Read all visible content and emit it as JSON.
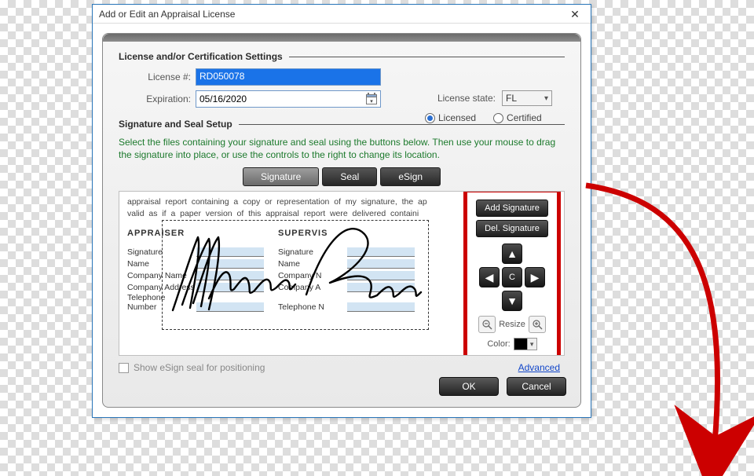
{
  "dialog": {
    "title": "Add or Edit an Appraisal License"
  },
  "section1": {
    "title": "License and/or Certification Settings",
    "license_label": "License #:",
    "license_value": "RD050078",
    "expiration_label": "Expiration:",
    "expiration_value": "05/16/2020",
    "state_label": "License state:",
    "state_value": "FL",
    "radio_licensed": "Licensed",
    "radio_certified": "Certified",
    "licensed_selected": true
  },
  "section2": {
    "title": "Signature and Seal Setup",
    "hint": "Select the files containing your signature and seal using the buttons below. Then use your mouse to drag the signature into place, or use the controls to the right to change its location.",
    "tabs": [
      "Signature",
      "Seal",
      "eSign"
    ],
    "active_tab": "Signature"
  },
  "preview": {
    "legal_line1": "appraisal  report  containing  a  copy  or  representation  of  my  signature,  the  ap",
    "legal_line2": "valid  as  if  a  paper  version  of  this  appraisal  report  were  delivered  containi",
    "left_title": "APPRAISER",
    "right_title": "SUPERVIS",
    "fields_left": [
      "Signature",
      "Name",
      "Company Name",
      "Company Address"
    ],
    "fields_right": [
      "Signature",
      "Name",
      "Company N",
      "Company A"
    ],
    "telephone": "Telephone Number",
    "telephone_r": "Telephone N"
  },
  "controls": {
    "add": "Add Signature",
    "del": "Del. Signature",
    "center": "C",
    "resize": "Resize",
    "color_label": "Color:",
    "color_value": "#000000"
  },
  "footer": {
    "checkbox": "Show eSign seal for positioning",
    "advanced": "Advanced"
  },
  "buttons": {
    "ok": "OK",
    "cancel": "Cancel"
  }
}
